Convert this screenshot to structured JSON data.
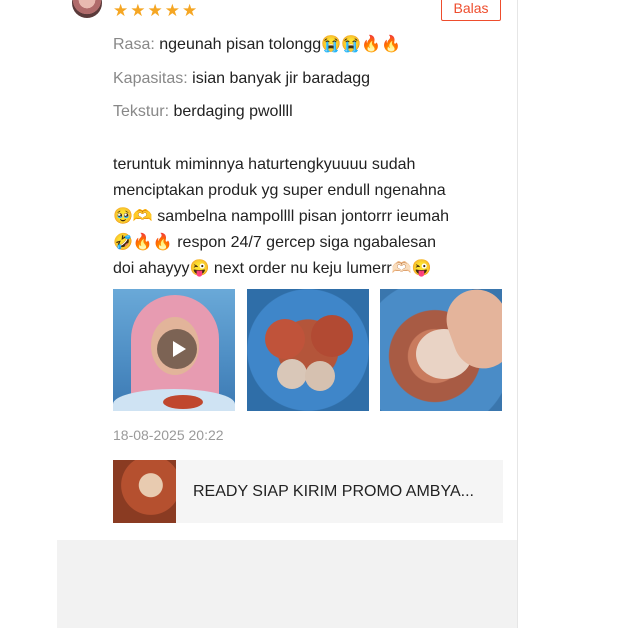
{
  "review": {
    "rating_stars": 5,
    "reply_label": "Balas",
    "attributes": [
      {
        "key": "Rasa: ",
        "value": "ngeunah pisan tolongg😭😭🔥🔥"
      },
      {
        "key": "Kapasitas: ",
        "value": "isian banyak jir baradagg"
      },
      {
        "key": "Tekstur: ",
        "value": "berdaging pwollll"
      }
    ],
    "body_lines": [
      "teruntuk miminnya haturtengkyuuuu sudah",
      "menciptakan produk yg super endull ngenahna",
      "🥹🫶 sambelna nampollll pisan jontorrr ieumah",
      "🤣🔥🔥 respon 24/7 gercep siga ngabalesan",
      "doi ahayyy😜 next order nu keju lumerr🫶🏻😜"
    ],
    "date": "18-08-2025 20:22"
  },
  "product": {
    "title": "READY SIAP KIRIM PROMO AMBYA..."
  },
  "colors": {
    "accent": "#ee4d2d",
    "star": "#f5a623"
  },
  "icons": {
    "star": "star-icon",
    "play": "play-icon"
  }
}
